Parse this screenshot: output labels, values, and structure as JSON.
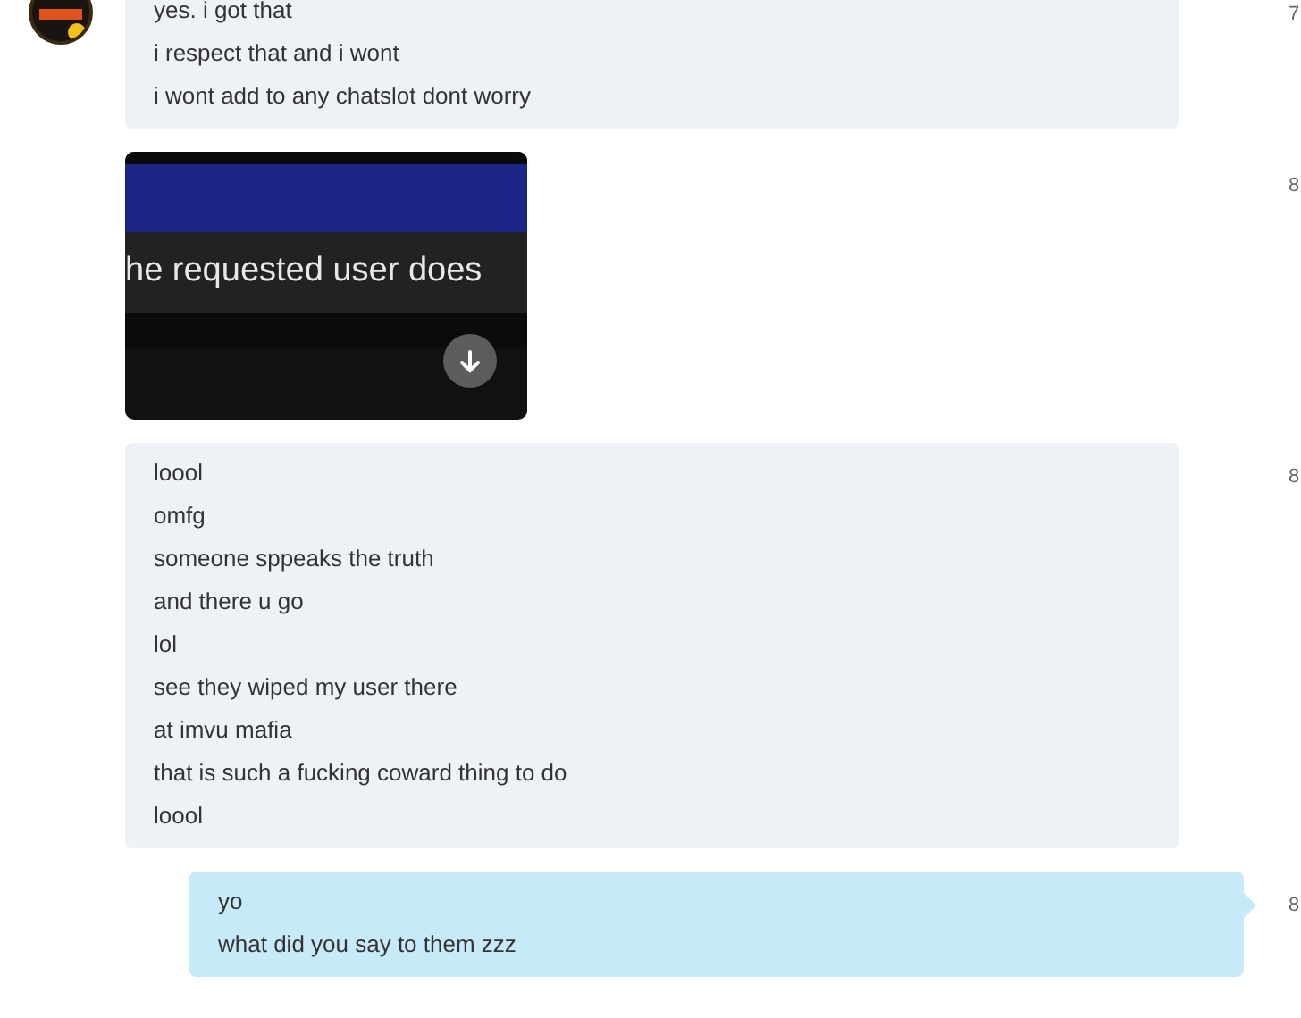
{
  "messages": [
    {
      "kind": "incoming",
      "avatar": true,
      "time": "7",
      "lines": [
        "yes. i got that",
        "i respect that and i wont",
        "i wont add to any chatslot dont worry"
      ]
    },
    {
      "kind": "image",
      "time": "8",
      "image_text": "he requested user does"
    },
    {
      "kind": "incoming",
      "time": "8",
      "lines": [
        "loool",
        "omfg",
        "someone sppeaks the truth",
        "and there u go",
        "lol",
        "see they wiped my user there",
        "at imvu mafia",
        "that is such a fucking coward thing to do",
        "loool"
      ]
    },
    {
      "kind": "outgoing",
      "time": "8",
      "lines": [
        "yo",
        "what did you say to them zzz"
      ]
    }
  ]
}
